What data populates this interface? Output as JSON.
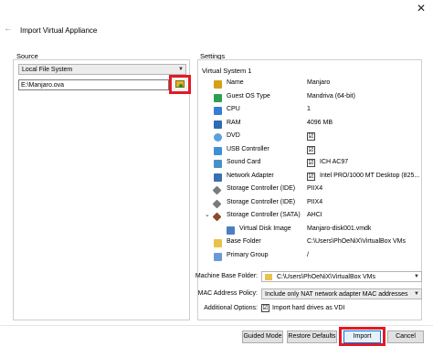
{
  "window": {
    "close_glyph": "✕"
  },
  "header": {
    "back_glyph": "←",
    "title": "Import Virtual Appliance"
  },
  "source": {
    "label": "Source",
    "combo_value": "Local File System",
    "file_value": "E:\\Manjaro.ova",
    "browse_icon": "folder-browse-icon"
  },
  "settings": {
    "label": "Settings",
    "system_header": "Virtual System 1",
    "rows": [
      {
        "label": "Name",
        "value": "Manjaro",
        "icon": "name-icon"
      },
      {
        "label": "Guest OS Type",
        "value": "Mandriva (64-bit)",
        "icon": "os-icon"
      },
      {
        "label": "CPU",
        "value": "1",
        "icon": "cpu-icon"
      },
      {
        "label": "RAM",
        "value": "4096 MB",
        "icon": "ram-icon"
      },
      {
        "label": "DVD",
        "value": "☑",
        "icon": "dvd-icon"
      },
      {
        "label": "USB Controller",
        "value": "☑",
        "icon": "usb-icon"
      },
      {
        "label": "Sound Card",
        "value": "ICH AC97",
        "icon": "sound-icon"
      },
      {
        "label": "Network Adapter",
        "value": "Intel PRO/1000 MT Desktop (825...",
        "icon": "network-icon"
      },
      {
        "label": "Storage Controller (IDE)",
        "value": "PIIX4",
        "icon": "storage-ide-icon"
      },
      {
        "label": "Storage Controller (IDE)",
        "value": "PIIX4",
        "icon": "storage-ide-icon"
      },
      {
        "label": "Storage Controller (SATA)",
        "value": "AHCI",
        "icon": "storage-sata-icon"
      },
      {
        "label": "Virtual Disk Image",
        "value": "Manjaro-disk001.vmdk",
        "icon": "disk-icon"
      },
      {
        "label": "Base Folder",
        "value": "C:\\Users\\PhOeNiX\\VirtualBox VMs",
        "icon": "folder-icon"
      },
      {
        "label": "Primary Group",
        "value": "/",
        "icon": "group-icon"
      }
    ]
  },
  "options": {
    "machine_base_folder_label": "Machine Base Folder:",
    "machine_base_folder_value": "C:\\Users\\PhOeNiX\\VirtualBox VMs",
    "mac_policy_label": "MAC Address Policy:",
    "mac_policy_value": "Include only NAT network adapter MAC addresses",
    "additional_options_label": "Additional Options:",
    "import_hard_drives_label": "Import hard drives as VDI",
    "import_hard_drives_checked": "☑"
  },
  "footer": {
    "guided_mode": "Guided Mode",
    "restore_defaults": "Restore Defaults",
    "import": "Import",
    "cancel": "Cancel"
  },
  "colors": {
    "highlight": "#e01b24",
    "selection": "#e5f1fb"
  }
}
